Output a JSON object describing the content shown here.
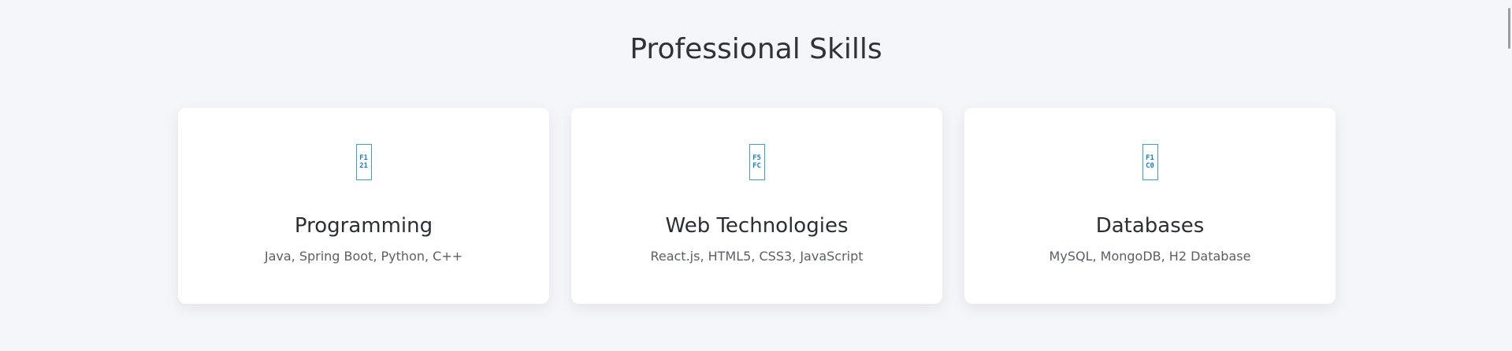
{
  "section": {
    "title": "Professional Skills"
  },
  "cards": [
    {
      "icon_name": "code-icon",
      "icon_line1": "F1",
      "icon_line2": "21",
      "title": "Programming",
      "description": "Java, Spring Boot, Python, C++"
    },
    {
      "icon_name": "web-icon",
      "icon_line1": "F5",
      "icon_line2": "FC",
      "title": "Web Technologies",
      "description": "React.js, HTML5, CSS3, JavaScript"
    },
    {
      "icon_name": "database-icon",
      "icon_line1": "F1",
      "icon_line2": "C0",
      "title": "Databases",
      "description": "MySQL, MongoDB, H2 Database"
    }
  ],
  "colors": {
    "background": "#f4f6f9",
    "card": "#ffffff",
    "icon_accent": "#1f7cc0"
  }
}
